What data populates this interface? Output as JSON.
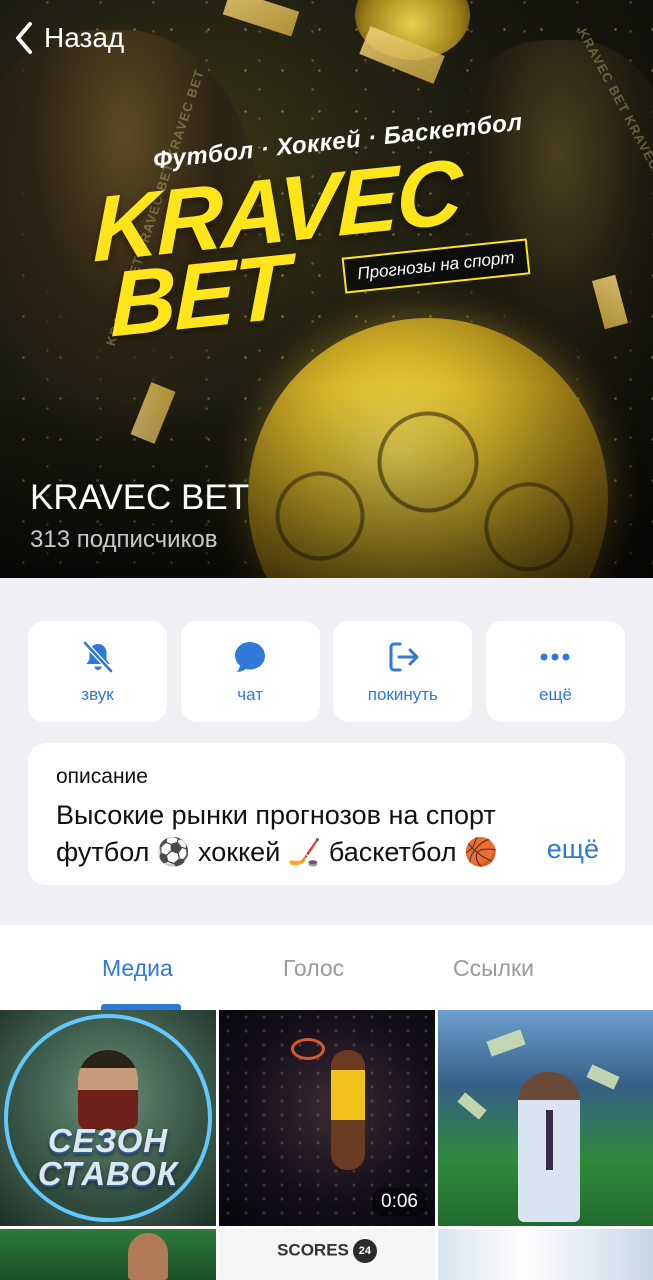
{
  "nav": {
    "back_label": "Назад"
  },
  "cover": {
    "sports_line": "Футбол · Хоккей · Баскетбол",
    "logo_line1": "KRAVEC",
    "logo_line2": "BET",
    "logo_tagline": "Прогнозы на спорт",
    "ring_text": "KRAVEC BET KRAVEC BET KRAVEC BET",
    "accent_color": "#ffe51a"
  },
  "channel": {
    "name": "KRAVEC BET",
    "subscribers": "313 подписчиков"
  },
  "actions": [
    {
      "label": "звук",
      "icon": "bell-slash-icon"
    },
    {
      "label": "чат",
      "icon": "chat-bubble-icon"
    },
    {
      "label": "покинуть",
      "icon": "leave-icon"
    },
    {
      "label": "ещё",
      "icon": "more-dots-icon"
    }
  ],
  "description": {
    "label": "описание",
    "line1": "Высокие рынки прогнозов на спорт",
    "line2": "футбол ⚽ хоккей 🏒 баскетбол 🏀",
    "more_label": "ещё"
  },
  "tabs": [
    {
      "label": "Медиа",
      "active": true
    },
    {
      "label": "Голос",
      "active": false
    },
    {
      "label": "Ссылки",
      "active": false
    }
  ],
  "media": {
    "item1_text_line1": "СЕЗОН",
    "item1_text_line2": "СТАВОК",
    "item2_duration": "0:06",
    "item5_brand": "SCORES",
    "item5_badge": "24"
  },
  "colors": {
    "link_blue": "#2f7ad6",
    "background": "#efeff4"
  }
}
